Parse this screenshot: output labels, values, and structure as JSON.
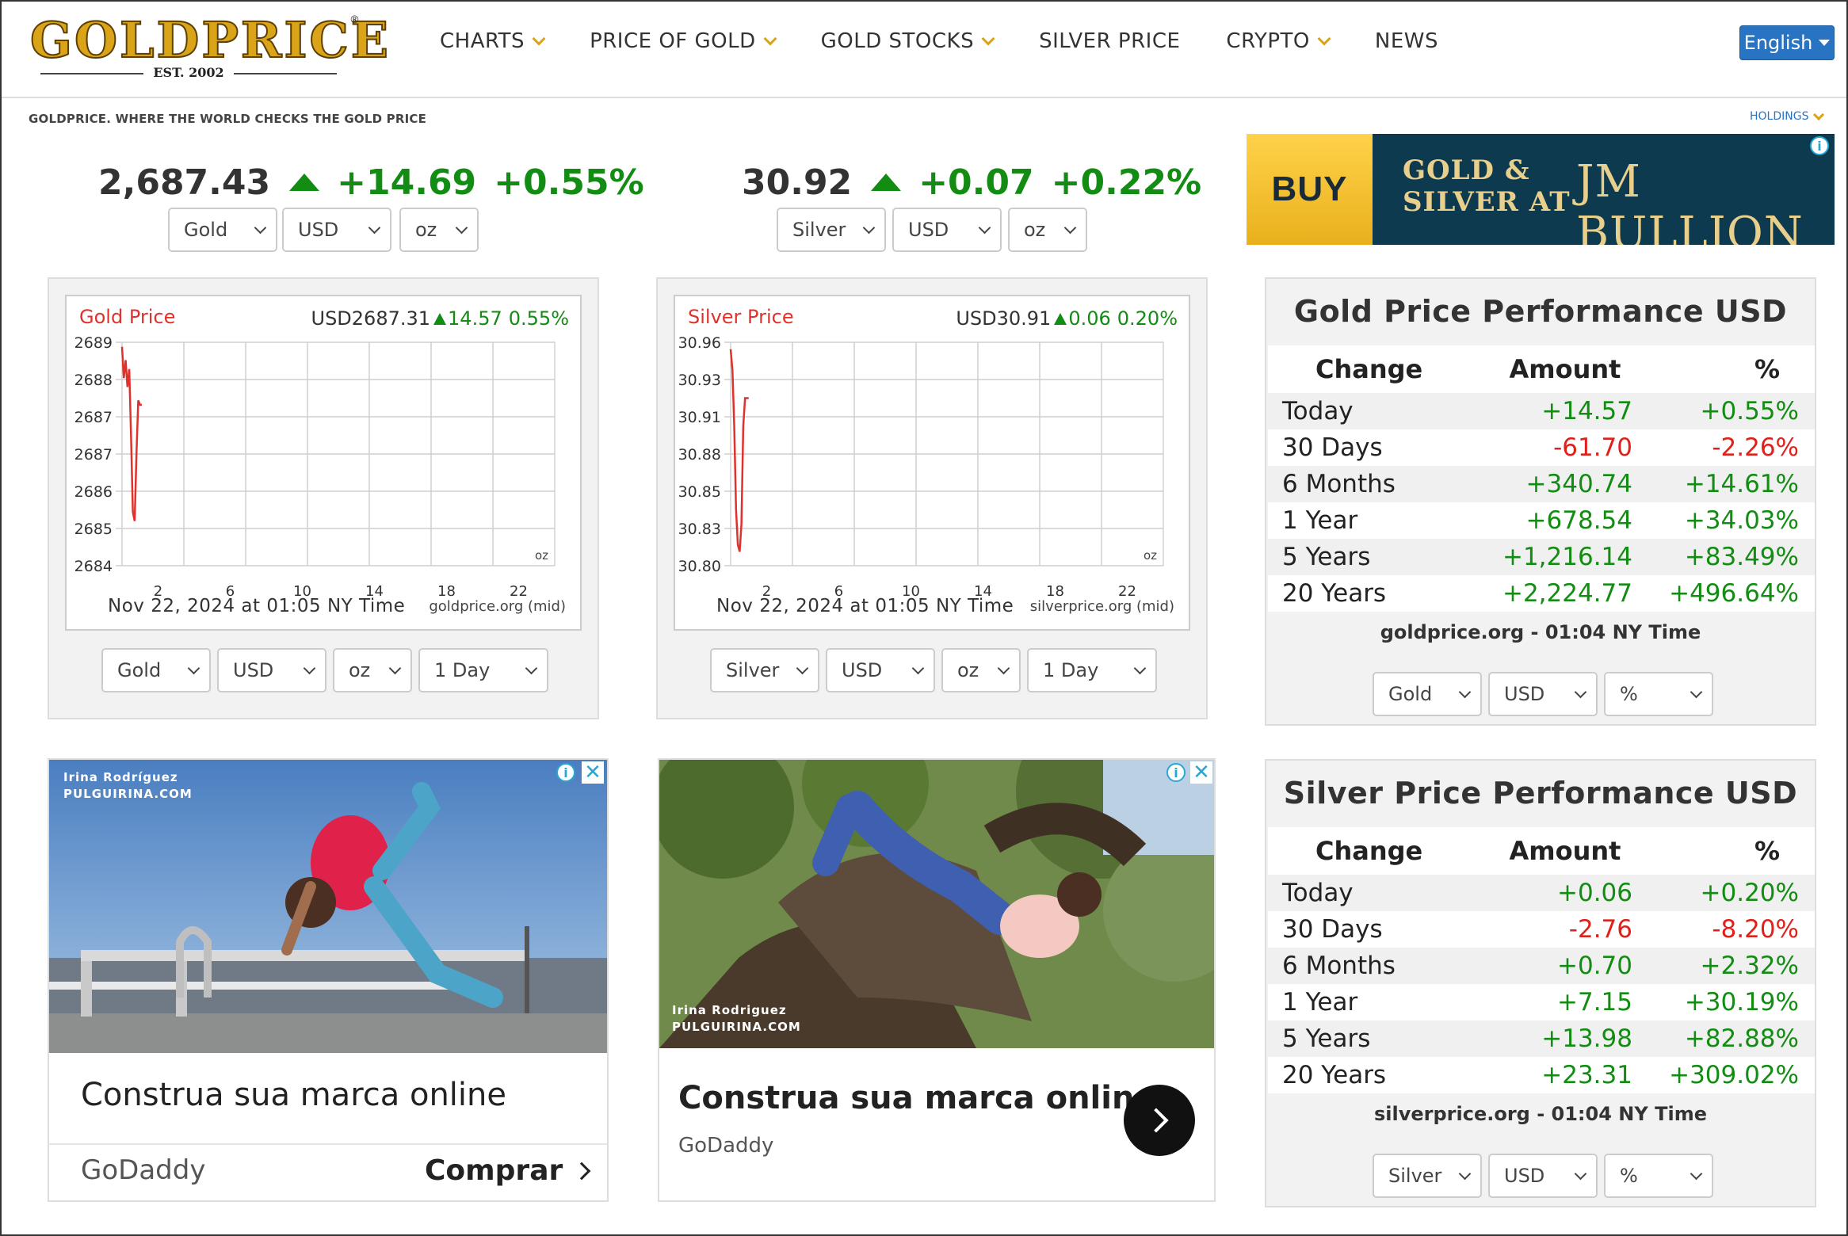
{
  "header": {
    "logo_text": "GOLDPRICE",
    "logo_est": "EST. 2002",
    "nav": [
      {
        "label": "CHARTS",
        "has_dropdown": true
      },
      {
        "label": "PRICE OF GOLD",
        "has_dropdown": true
      },
      {
        "label": "GOLD STOCKS",
        "has_dropdown": true
      },
      {
        "label": "SILVER PRICE",
        "has_dropdown": false
      },
      {
        "label": "CRYPTO",
        "has_dropdown": true
      },
      {
        "label": "NEWS",
        "has_dropdown": false
      }
    ],
    "language": "English"
  },
  "tagline": "GOLDPRICE. WHERE THE WORLD CHECKS THE GOLD PRICE",
  "holdings_label": "HOLDINGS",
  "gold_ticker": {
    "price": "2,687.43",
    "change": "+14.69",
    "percent": "+0.55%",
    "metal": "Gold",
    "currency": "USD",
    "unit": "oz"
  },
  "silver_ticker": {
    "price": "30.92",
    "change": "+0.07",
    "percent": "+0.22%",
    "metal": "Silver",
    "currency": "USD",
    "unit": "oz"
  },
  "gold_chart_panel": {
    "title": "Gold Price",
    "readout_price": "USD2687.31",
    "readout_change": "14.57",
    "readout_percent": "0.55%",
    "footer": "Nov 22, 2024 at 01:05 NY Time",
    "source": "goldprice.org (mid)",
    "metal": "Gold",
    "currency": "USD",
    "unit": "oz",
    "range": "1 Day"
  },
  "silver_chart_panel": {
    "title": "Silver Price",
    "readout_price": "USD30.91",
    "readout_change": "0.06",
    "readout_percent": "0.20%",
    "footer": "Nov 22, 2024 at 01:05 NY Time",
    "source": "silverprice.org (mid)",
    "metal": "Silver",
    "currency": "USD",
    "unit": "oz",
    "range": "1 Day"
  },
  "chart_data": [
    {
      "type": "line",
      "title": "Gold Price",
      "unit_label": "oz",
      "y_tick_labels": [
        "2689",
        "2688",
        "2687",
        "2687",
        "2686",
        "2685",
        "2684"
      ],
      "x_tick_labels": [
        "2",
        "6",
        "10",
        "14",
        "18",
        "22"
      ],
      "ylim": [
        2684,
        2689
      ],
      "xlim": [
        0,
        24
      ],
      "x": [
        0,
        0.1,
        0.2,
        0.3,
        0.4,
        0.5,
        0.6,
        0.7,
        0.8,
        0.9,
        1.0,
        1.1
      ],
      "y": [
        2688.9,
        2688.2,
        2688.6,
        2688.0,
        2688.4,
        2686.9,
        2685.2,
        2685.0,
        2686.5,
        2687.7,
        2687.6,
        2687.6
      ],
      "color": "#e0322c",
      "grid": true
    },
    {
      "type": "line",
      "title": "Silver Price",
      "unit_label": "oz",
      "y_tick_labels": [
        "30.96",
        "30.93",
        "30.91",
        "30.88",
        "30.85",
        "30.83",
        "30.80"
      ],
      "x_tick_labels": [
        "2",
        "6",
        "10",
        "14",
        "18",
        "22"
      ],
      "ylim": [
        30.8,
        30.96
      ],
      "xlim": [
        0,
        24
      ],
      "x": [
        0,
        0.1,
        0.2,
        0.3,
        0.4,
        0.5,
        0.6,
        0.7,
        0.8,
        0.9,
        1.0
      ],
      "y": [
        30.955,
        30.94,
        30.9,
        30.84,
        30.815,
        30.81,
        30.83,
        30.9,
        30.92,
        30.92,
        30.92
      ],
      "color": "#e0322c",
      "grid": true
    }
  ],
  "jm_ad": {
    "buy": "BUY",
    "line1": "GOLD &",
    "line2": "SILVER AT",
    "brand": "JM BULLION"
  },
  "ad1": {
    "credit_name": "Irina Rodríguez",
    "credit_site": "PULGUIRINA.COM",
    "headline": "Construa sua marca online",
    "brand": "GoDaddy",
    "cta": "Comprar"
  },
  "ad2": {
    "credit_name": "Irina Rodriguez",
    "credit_site": "PULGUIRINA.COM",
    "headline": "Construa sua marca online",
    "brand": "GoDaddy"
  },
  "gold_perf": {
    "title": "Gold Price Performance USD",
    "headers": [
      "Change",
      "Amount",
      "%"
    ],
    "rows": [
      {
        "label": "Today",
        "amount": "+14.57",
        "percent": "+0.55%",
        "sign": "pos"
      },
      {
        "label": "30 Days",
        "amount": "-61.70",
        "percent": "-2.26%",
        "sign": "neg"
      },
      {
        "label": "6 Months",
        "amount": "+340.74",
        "percent": "+14.61%",
        "sign": "pos"
      },
      {
        "label": "1 Year",
        "amount": "+678.54",
        "percent": "+34.03%",
        "sign": "pos"
      },
      {
        "label": "5 Years",
        "amount": "+1,216.14",
        "percent": "+83.49%",
        "sign": "pos"
      },
      {
        "label": "20 Years",
        "amount": "+2,224.77",
        "percent": "+496.64%",
        "sign": "pos"
      }
    ],
    "source": "goldprice.org - 01:04 NY Time",
    "metal": "Gold",
    "currency": "USD",
    "mode": "%"
  },
  "silver_perf": {
    "title": "Silver Price Performance USD",
    "headers": [
      "Change",
      "Amount",
      "%"
    ],
    "rows": [
      {
        "label": "Today",
        "amount": "+0.06",
        "percent": "+0.20%",
        "sign": "pos"
      },
      {
        "label": "30 Days",
        "amount": "-2.76",
        "percent": "-8.20%",
        "sign": "neg"
      },
      {
        "label": "6 Months",
        "amount": "+0.70",
        "percent": "+2.32%",
        "sign": "pos"
      },
      {
        "label": "1 Year",
        "amount": "+7.15",
        "percent": "+30.19%",
        "sign": "pos"
      },
      {
        "label": "5 Years",
        "amount": "+13.98",
        "percent": "+82.88%",
        "sign": "pos"
      },
      {
        "label": "20 Years",
        "amount": "+23.31",
        "percent": "+309.02%",
        "sign": "pos"
      }
    ],
    "source": "silverprice.org - 01:04 NY Time",
    "metal": "Silver",
    "currency": "USD",
    "mode": "%"
  },
  "colors": {
    "up": "#128c12",
    "down": "#e0201a",
    "chart_line": "#e0322c",
    "accent_gold": "#d9a417",
    "link_blue": "#2874c2"
  }
}
